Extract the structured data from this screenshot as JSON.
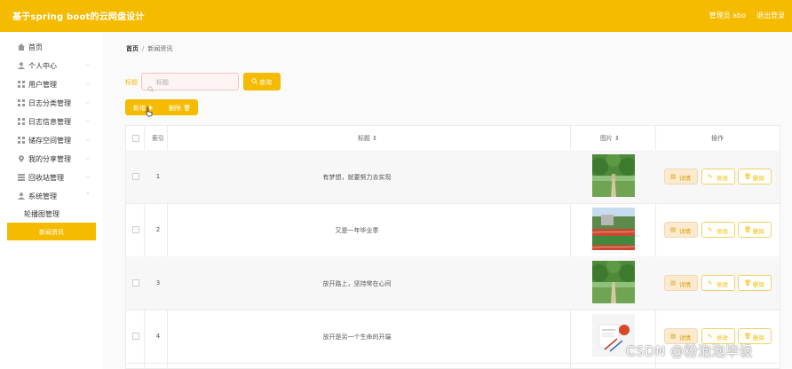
{
  "header": {
    "app_title": "基于spring boot的云网盘设计",
    "user_label": "管理员 abo",
    "logout_label": "退出登录"
  },
  "sidebar": {
    "items": [
      {
        "label": "首页",
        "icon": "home-icon"
      },
      {
        "label": "个人中心",
        "icon": "user-icon"
      },
      {
        "label": "用户管理",
        "icon": "grid-icon"
      },
      {
        "label": "日志分类管理",
        "icon": "grid-icon"
      },
      {
        "label": "日志信息管理",
        "icon": "grid-icon"
      },
      {
        "label": "储存空间管理",
        "icon": "grid-icon"
      },
      {
        "label": "我的分享管理",
        "icon": "location-icon"
      },
      {
        "label": "回收站管理",
        "icon": "grid-icon"
      },
      {
        "label": "系统管理",
        "icon": "user-icon"
      }
    ],
    "sub_items": [
      {
        "label": "轮播图管理"
      },
      {
        "label": "新闻资讯"
      }
    ]
  },
  "breadcrumb": {
    "home": "首页",
    "separator": "/",
    "current": "新闻资讯"
  },
  "search": {
    "label": "标题",
    "placeholder": "标题",
    "query_button": "查询"
  },
  "toolbar": {
    "add_label": "新增 ✚",
    "delete_label": "删除 🗑"
  },
  "table": {
    "headers": {
      "index": "索引",
      "title": "标题",
      "image": "图片",
      "action": "操作"
    },
    "rows": [
      {
        "index": "1",
        "title": "有梦想，就要努力去实现",
        "image": "campus-trees"
      },
      {
        "index": "2",
        "title": "又是一年毕业季",
        "image": "running-track"
      },
      {
        "index": "3",
        "title": "放开路上，坚持常在心间",
        "image": "campus-trees"
      },
      {
        "index": "4",
        "title": "放开是另一个生命的开端",
        "image": "document-pen"
      }
    ],
    "actions": {
      "detail": "详情",
      "edit": "修改",
      "delete": "删除"
    }
  },
  "watermark": "CSDN @粉泡泡毕设",
  "colors": {
    "accent": "#f5bb00",
    "danger_tint": "#fff4f4"
  }
}
